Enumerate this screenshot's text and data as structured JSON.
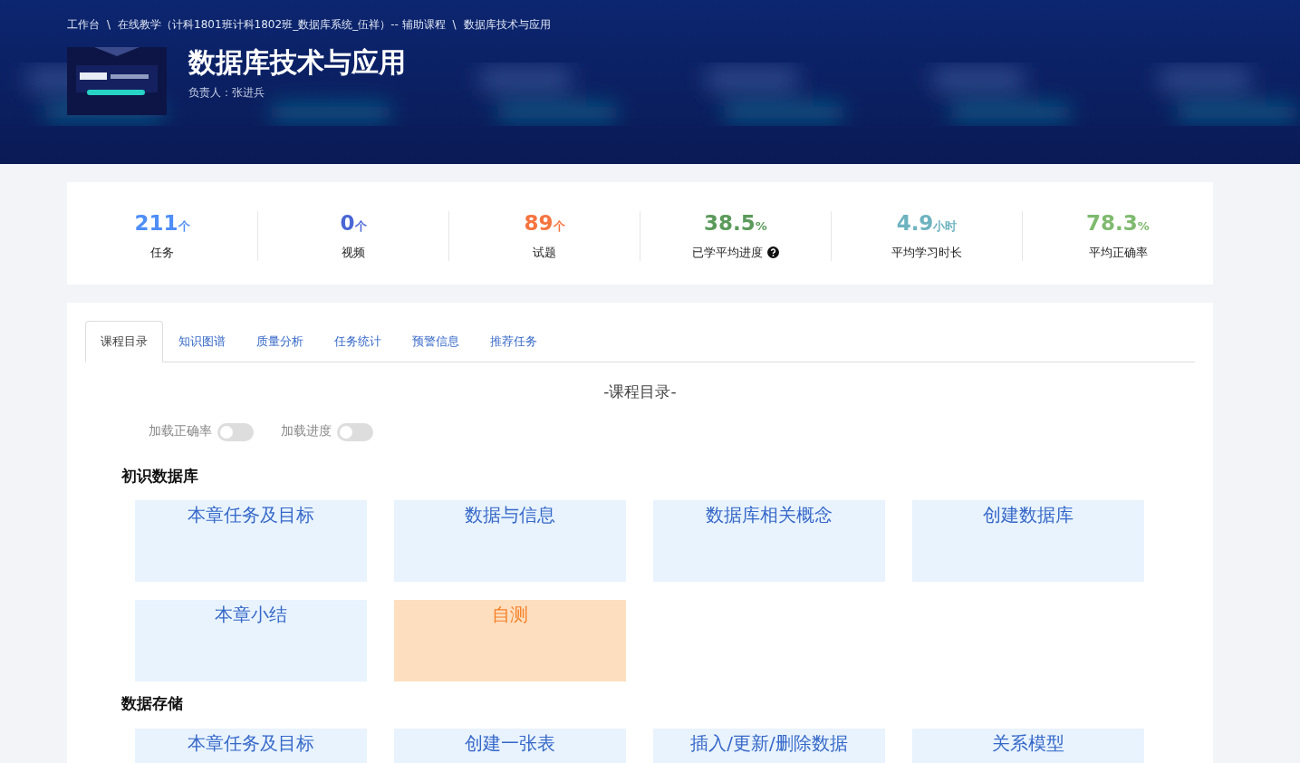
{
  "breadcrumb": [
    "工作台",
    "在线教学（计科1801班计科1802班_数据库系统_伍祥）-- 辅助课程",
    "数据库技术与应用"
  ],
  "breadcrumb_separators": [
    "\\",
    "\\"
  ],
  "course": {
    "title": "数据库技术与应用",
    "owner": "负责人：张进兵"
  },
  "stats": [
    {
      "value": "211",
      "unit": "个",
      "label": "任务",
      "color": "#4f8ef7",
      "help": false
    },
    {
      "value": "0",
      "unit": "个",
      "label": "视频",
      "color": "#4a67d6",
      "help": false
    },
    {
      "value": "89",
      "unit": "个",
      "label": "试题",
      "color": "#f5743f",
      "help": false
    },
    {
      "value": "38.5",
      "unit": "%",
      "label": "已学平均进度",
      "color": "#5b9a5b",
      "help": true
    },
    {
      "value": "4.9",
      "unit": "小时",
      "label": "平均学习时长",
      "color": "#6db3c0",
      "help": false
    },
    {
      "value": "78.3",
      "unit": "%",
      "label": "平均正确率",
      "color": "#7fba6f",
      "help": false
    }
  ],
  "tabs": [
    {
      "label": "课程目录",
      "selected": true
    },
    {
      "label": "知识图谱",
      "selected": false
    },
    {
      "label": "质量分析",
      "selected": false
    },
    {
      "label": "任务统计",
      "selected": false
    },
    {
      "label": "预警信息",
      "selected": false
    },
    {
      "label": "推荐任务",
      "selected": false
    }
  ],
  "catalog_title": "-课程目录-",
  "toggles": [
    {
      "label": "加载正确率",
      "on": false
    },
    {
      "label": "加载进度",
      "on": false
    }
  ],
  "chapters": [
    {
      "title": "初识数据库",
      "items": [
        {
          "label": "本章任务及目标",
          "kind": "task"
        },
        {
          "label": "数据与信息",
          "kind": "task"
        },
        {
          "label": "数据库相关概念",
          "kind": "task"
        },
        {
          "label": "创建数据库",
          "kind": "task"
        },
        {
          "label": "本章小结",
          "kind": "task"
        },
        {
          "label": "自测",
          "kind": "test"
        }
      ]
    },
    {
      "title": "数据存储",
      "items": [
        {
          "label": "本章任务及目标",
          "kind": "task"
        },
        {
          "label": "创建一张表",
          "kind": "task"
        },
        {
          "label": "插入/更新/删除数据",
          "kind": "task"
        },
        {
          "label": "关系模型",
          "kind": "task"
        }
      ]
    }
  ]
}
